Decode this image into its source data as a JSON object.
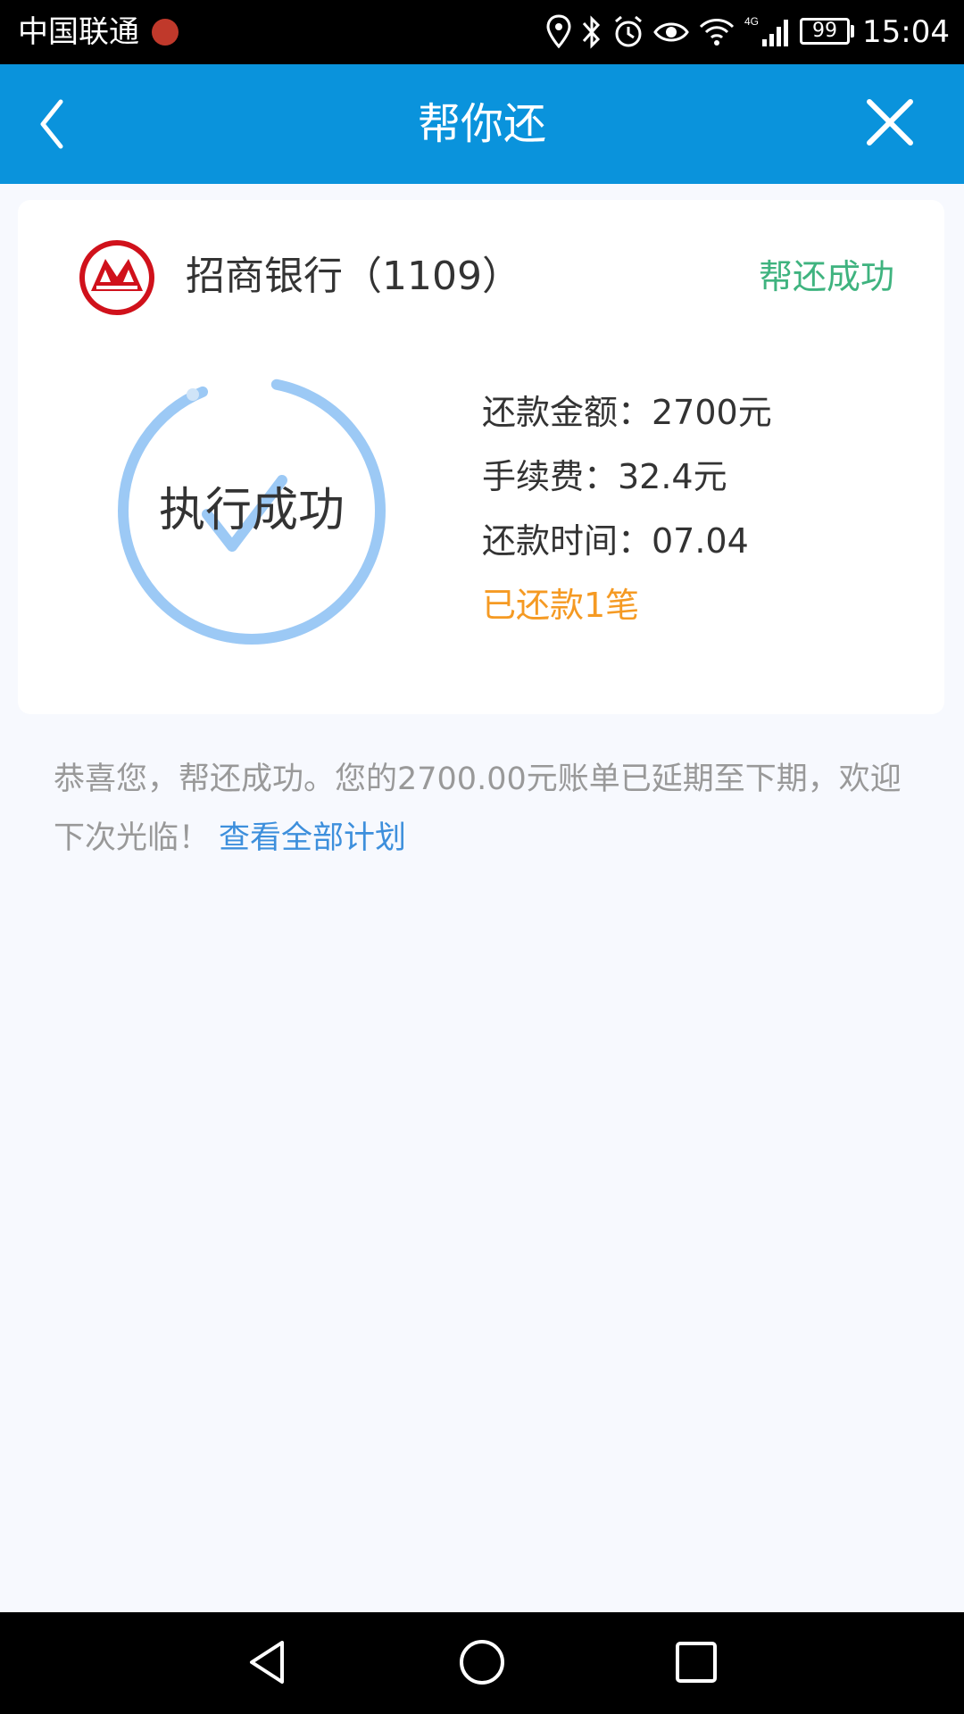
{
  "status_bar": {
    "carrier": "中国联通",
    "battery": "99",
    "time": "15:04",
    "icons": [
      "location-icon",
      "bluetooth-icon",
      "alarm-icon",
      "eye-icon",
      "wifi-icon",
      "signal-4g-icon",
      "battery-icon"
    ]
  },
  "nav": {
    "title": "帮你还",
    "back_icon": "chevron-left-icon",
    "close_icon": "close-icon"
  },
  "card": {
    "bank_name": "招商银行（1109）",
    "status": "帮还成功",
    "ring_label": "执行成功",
    "details": {
      "amount": "还款金额：2700元",
      "fee": "手续费：32.4元",
      "time": "还款时间：07.04",
      "count": "已还款1笔"
    }
  },
  "message": {
    "text": "恭喜您，帮还成功。您的2700.00元账单已延期至下期，欢迎下次光临！",
    "link": "查看全部计划"
  },
  "colors": {
    "nav_bg": "#0a93dc",
    "success_green": "#3fb37f",
    "orange": "#f59a23",
    "link_blue": "#3d8fdc",
    "ring_blue": "#9cc9f5",
    "bank_red": "#d0111b"
  }
}
